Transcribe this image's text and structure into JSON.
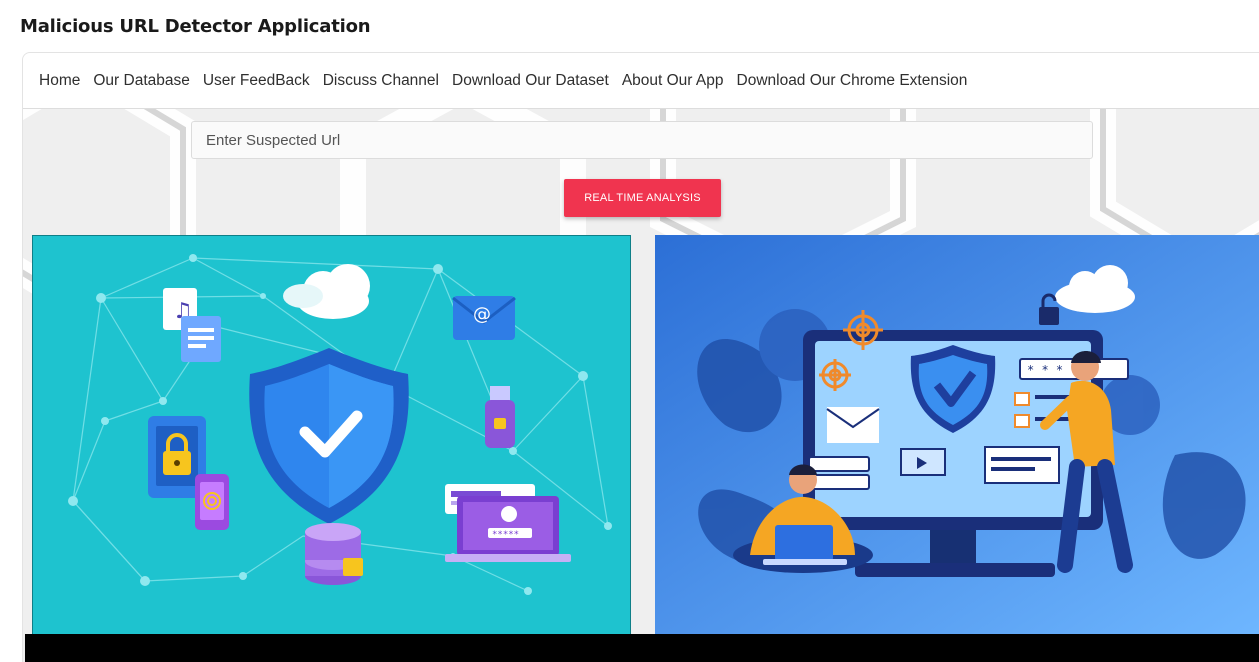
{
  "app": {
    "title": "Malicious URL Detector Application"
  },
  "nav": {
    "items": [
      {
        "label": "Home"
      },
      {
        "label": "Our Database"
      },
      {
        "label": "User FeedBack"
      },
      {
        "label": "Discuss Channel"
      },
      {
        "label": "Download Our Dataset"
      },
      {
        "label": "About Our App"
      },
      {
        "label": "Download Our Chrome Extension"
      }
    ]
  },
  "search": {
    "placeholder": "Enter Suspected Url",
    "value": ""
  },
  "actions": {
    "analyze_label": "REAL TIME ANALYSIS"
  },
  "illustrations": {
    "left": {
      "password_mask": "*****"
    },
    "right": {
      "password_mask": "* * *"
    }
  },
  "colors": {
    "accent": "#f0344f",
    "left_panel_bg": "#1ec3cf",
    "right_panel_bg": "#3a82db",
    "shield_blue": "#1e6fd9",
    "footer_bg": "#000000"
  }
}
